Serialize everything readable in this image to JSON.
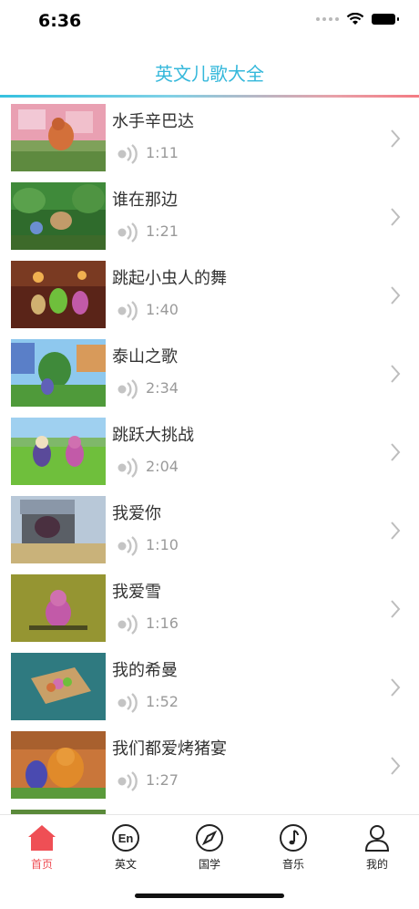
{
  "status": {
    "time": "6:36"
  },
  "header": {
    "title": "英文儿歌大全"
  },
  "songs": [
    {
      "title": "水手辛巴达",
      "duration": "1:11"
    },
    {
      "title": "谁在那边",
      "duration": "1:21"
    },
    {
      "title": "跳起小虫人的舞",
      "duration": "1:40"
    },
    {
      "title": "泰山之歌",
      "duration": "2:34"
    },
    {
      "title": "跳跃大挑战",
      "duration": "2:04"
    },
    {
      "title": "我爱你",
      "duration": "1:10"
    },
    {
      "title": "我爱雪",
      "duration": "1:16"
    },
    {
      "title": "我的希曼",
      "duration": "1:52"
    },
    {
      "title": "我们都爱烤猪宴",
      "duration": "1:27"
    }
  ],
  "tabs": [
    {
      "label": "首页",
      "icon": "home-icon",
      "active": true
    },
    {
      "label": "英文",
      "icon": "en-icon",
      "active": false
    },
    {
      "label": "国学",
      "icon": "compass-icon",
      "active": false
    },
    {
      "label": "音乐",
      "icon": "music-note-icon",
      "active": false
    },
    {
      "label": "我的",
      "icon": "person-icon",
      "active": false
    }
  ],
  "colors": {
    "accent": "#35b8db",
    "active_tab": "#ef4f55"
  }
}
